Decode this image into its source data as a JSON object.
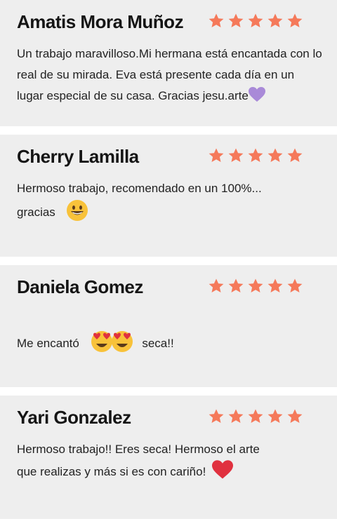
{
  "reviews": [
    {
      "name": "Amatis Mora Muñoz",
      "rating": 5,
      "text": "Un trabajo maravilloso.Mi hermana está encantada con lo real de su mirada. Eva está presente cada día en un lugar especial de su casa. Gracias jesu.arte",
      "emoji": "purple-heart-icon"
    },
    {
      "name": "Cherry Lamilla",
      "rating": 5,
      "text_line1": "Hermoso trabajo, recomendado en un 100%...",
      "text_line2": "gracias",
      "emoji": "smiley-face-icon"
    },
    {
      "name": "Daniela Gomez",
      "rating": 5,
      "text_before": "Me encantó",
      "text_after": "seca!!",
      "emoji": "heart-eyes-face-icon"
    },
    {
      "name": "Yari Gonzalez",
      "rating": 5,
      "text_line1": "Hermoso trabajo!! Eres seca! Hermoso el arte",
      "text_line2": "que realizas y más si es con cariño!",
      "emoji": "red-heart-icon"
    }
  ],
  "colors": {
    "card_bg": "#eeeeee",
    "star": "#f5795a",
    "purple_heart": "#a98ad8",
    "red_heart": "#e0313f",
    "emoji_yellow": "#f8c23a"
  }
}
